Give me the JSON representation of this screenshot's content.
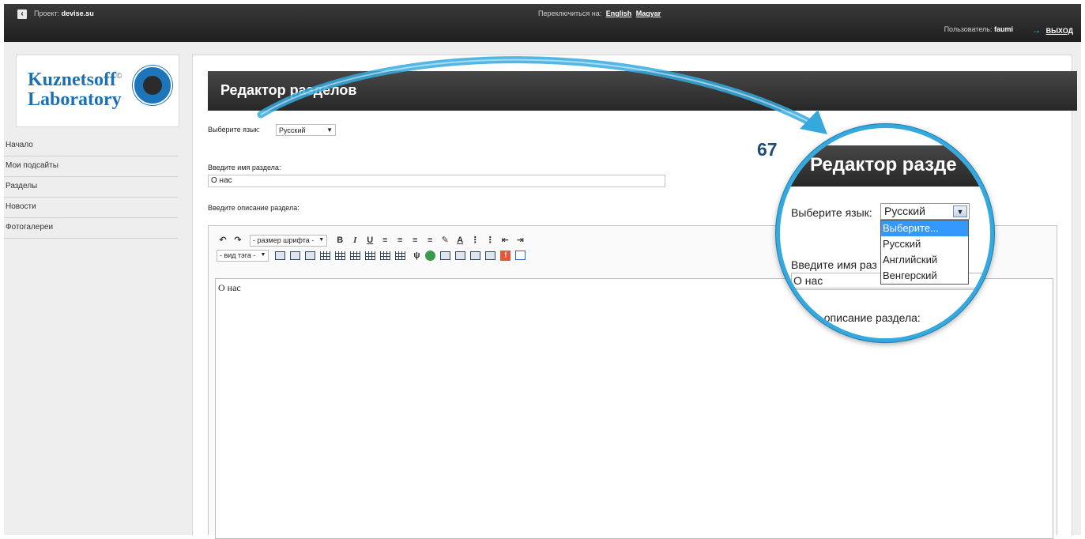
{
  "topbar": {
    "back_icon": "chevron-left-icon",
    "project_label": "Проект:",
    "project_name": "devise.su",
    "switch_label": "Переключиться на:",
    "switch_links": [
      "English",
      "Magyar"
    ],
    "user_label": "Пользователь:",
    "user_name": "faumi",
    "logout_label": "ВЫХОД"
  },
  "logo": {
    "line1": "Kuznetsoff",
    "line2": "Laboratory",
    "mark": "©"
  },
  "sidebar": {
    "items": [
      {
        "label": "Начало"
      },
      {
        "label": "Мои подсайты"
      },
      {
        "label": "Разделы"
      },
      {
        "label": "Новости"
      },
      {
        "label": "Фотогалереи"
      }
    ]
  },
  "main": {
    "title": "Редактор разделов",
    "language_label": "Выберите язык:",
    "language_value": "Русский",
    "name_label": "Введите имя раздела:",
    "name_value": "О нас",
    "description_label": "Введите описание раздела:",
    "editor": {
      "font_size_select": "- размер шрифта -",
      "tag_select": "- вид тэга -",
      "content": "О нас"
    }
  },
  "callout": {
    "step_number": "67",
    "title": "Редактор разде",
    "language_label": "Выберите язык:",
    "language_value": "Русский",
    "dropdown_options": [
      "Выберите...",
      "Русский",
      "Английский",
      "Венгерский"
    ],
    "highlighted_option": "Выберите...",
    "name_label": "Введите имя раз",
    "name_value": "О нас",
    "description_label": "ите описание раздела:",
    "accent_color": "#35a9de"
  }
}
